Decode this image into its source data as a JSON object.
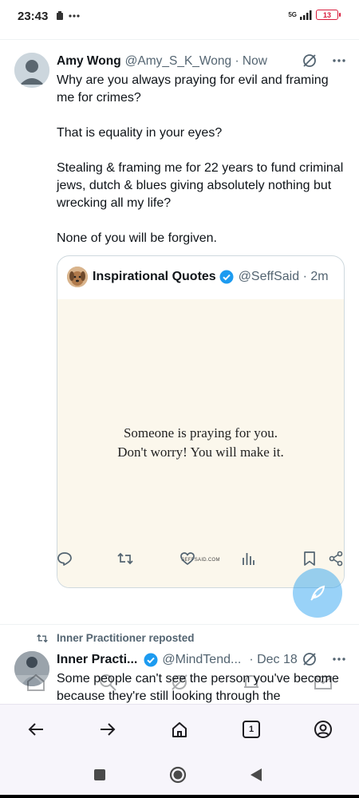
{
  "status_bar": {
    "time": "23:43",
    "network": "5G",
    "battery": "13"
  },
  "tweet": {
    "name": "Amy Wong",
    "handle": "@Amy_S_K_Wong · Now",
    "text": "Why are you always praying for evil and framing me for crimes?\n\nThat is equality in your eyes?\n\nStealing & framing me for 22 years to fund criminal jews, dutch & blues giving absolutely nothing but wrecking all my life?\n\nNone of you will be forgiven.",
    "quote": {
      "name": "Inspirational Quotes",
      "handle": "@SeffSaid · 2m",
      "image_text_line1": "Someone is praying for you.",
      "image_text_line2": "Don't worry! You will make it.",
      "image_credit": "SEFFSAID.COM"
    }
  },
  "next_tweet": {
    "repost_label": "Inner Practitioner reposted",
    "name": "Inner Practi...",
    "handle": "@MindTend...",
    "date": "· Dec 18",
    "text": "Some people can't see the person you've become because they're still looking through the"
  },
  "browser_bar": {
    "tab_count": "1"
  },
  "colors": {
    "accent": "#1d9bf0",
    "secondary_text": "#536471",
    "quote_background": "#fbf7ec"
  }
}
